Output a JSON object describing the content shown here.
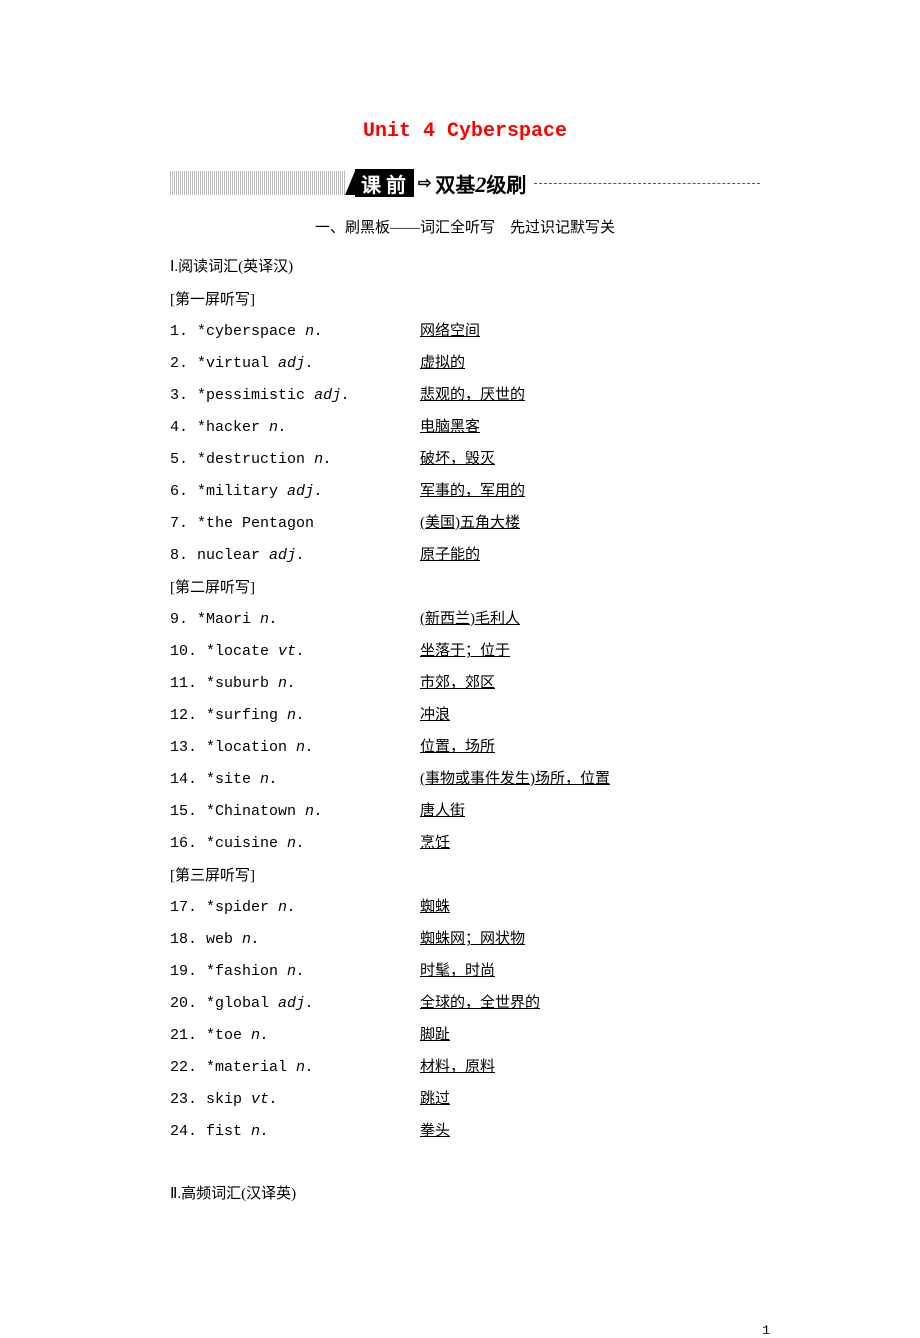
{
  "title": "Unit 4 Cyberspace",
  "banner": {
    "black_text": "课 前",
    "arrow": "⇨",
    "text_prefix": "双基",
    "text_num": "2",
    "text_suffix": "级刷"
  },
  "section_title": "一、刷黑板——词汇全听写　先过识记默写关",
  "sub1": "Ⅰ.阅读词汇(英译汉)",
  "screens": [
    {
      "label": "[第一屏听写]",
      "items": [
        {
          "n": "1.",
          "star": "*",
          "word": "cyberspace",
          "pos": "n.",
          "def": "网络空间"
        },
        {
          "n": "2.",
          "star": "*",
          "word": "virtual",
          "pos": "adj.",
          "def": "虚拟的"
        },
        {
          "n": "3.",
          "star": "*",
          "word": "pessimistic",
          "pos": "adj.",
          "def": "悲观的，厌世的"
        },
        {
          "n": "4.",
          "star": "*",
          "word": "hacker",
          "pos": "n.",
          "def": "电脑黑客"
        },
        {
          "n": "5.",
          "star": "*",
          "word": "destruction",
          "pos": "n.",
          "def": "破坏，毁灭"
        },
        {
          "n": "6.",
          "star": "*",
          "word": "military",
          "pos": "adj.",
          "def": "军事的，军用的"
        },
        {
          "n": "7.",
          "star": "*",
          "word": "the Pentagon",
          "pos": "",
          "def": "(美国)五角大楼"
        },
        {
          "n": "8.",
          "star": "",
          "word": "nuclear",
          "pos": "adj.",
          "def": "原子能的"
        }
      ]
    },
    {
      "label": "[第二屏听写]",
      "items": [
        {
          "n": "9.",
          "star": "*",
          "word": "Maori",
          "pos": "n.",
          "def": "(新西兰)毛利人"
        },
        {
          "n": "10.",
          "star": "*",
          "word": "locate",
          "pos": "vt.",
          "def": "坐落于；位于"
        },
        {
          "n": "11.",
          "star": "*",
          "word": "suburb",
          "pos": "n.",
          "def": "市郊，郊区"
        },
        {
          "n": "12.",
          "star": "*",
          "word": "surfing",
          "pos": "n.",
          "def": "冲浪"
        },
        {
          "n": "13.",
          "star": "*",
          "word": "location",
          "pos": "n.",
          "def": "位置，场所"
        },
        {
          "n": "14.",
          "star": "*",
          "word": "site",
          "pos": "n.",
          "def": "(事物或事件发生)场所，位置"
        },
        {
          "n": "15.",
          "star": "*",
          "word": "Chinatown",
          "pos": "n.",
          "def": "唐人街"
        },
        {
          "n": "16.",
          "star": "*",
          "word": "cuisine",
          "pos": "n.",
          "def": "烹饪"
        }
      ]
    },
    {
      "label": "[第三屏听写]",
      "items": [
        {
          "n": "17.",
          "star": "*",
          "word": "spider",
          "pos": "n.",
          "def": "蜘蛛"
        },
        {
          "n": "18.",
          "star": "",
          "word": "web",
          "pos": "n.",
          "def": "蜘蛛网；网状物"
        },
        {
          "n": "19.",
          "star": "*",
          "word": "fashion",
          "pos": "n.",
          "def": "时髦，时尚"
        },
        {
          "n": "20.",
          "star": "*",
          "word": "global",
          "pos": "adj.",
          "def": "全球的，全世界的"
        },
        {
          "n": "21.",
          "star": "*",
          "word": "toe",
          "pos": "n.",
          "def": "脚趾"
        },
        {
          "n": "22.",
          "star": "*",
          "word": "material",
          "pos": "n.",
          "def": "材料，原料"
        },
        {
          "n": "23.",
          "star": "",
          "word": "skip",
          "pos": "vt.",
          "def": "跳过"
        },
        {
          "n": "24.",
          "star": "",
          "word": "fist",
          "pos": "n.",
          "def": "拳头"
        }
      ]
    }
  ],
  "sub2": "Ⅱ.高频词汇(汉译英)",
  "page_num": "1"
}
